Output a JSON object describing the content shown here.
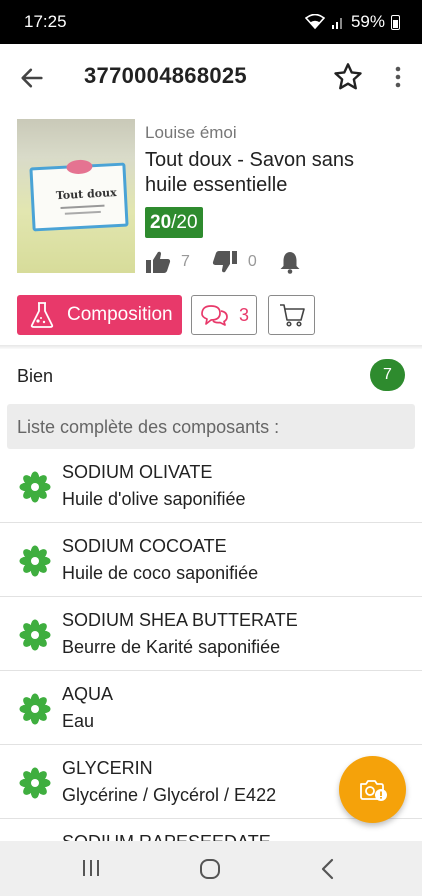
{
  "status_bar": {
    "time": "17:25",
    "battery_text": "59%"
  },
  "app_bar": {
    "title": "3770004868025",
    "back_icon": "arrow-left-icon",
    "favorite_icon": "star-outline-icon",
    "more_icon": "more-vert-icon"
  },
  "product": {
    "brand": "Louise émoi",
    "name": "Tout doux - Savon sans huile essentielle",
    "score_value": "20",
    "score_max": "/20",
    "score_color": "#2e8b2e",
    "likes": "7",
    "dislikes": "0",
    "image_label": "Tout doux"
  },
  "actions": {
    "composition_label": "Composition",
    "comments_count": "3",
    "accent_color": "#e8396a"
  },
  "rating_row": {
    "label": "Bien",
    "count": "7"
  },
  "section": {
    "title": "Liste complète des composants :"
  },
  "ingredients": [
    {
      "name": "SODIUM OLIVATE",
      "description": "Huile d'olive saponifiée",
      "icon": "green-flower-icon"
    },
    {
      "name": "SODIUM COCOATE",
      "description": "Huile de coco saponifiée",
      "icon": "green-flower-icon"
    },
    {
      "name": "SODIUM SHEA BUTTERATE",
      "description": "Beurre de Karité saponifiée",
      "icon": "green-flower-icon"
    },
    {
      "name": "AQUA",
      "description": "Eau",
      "icon": "green-flower-icon"
    },
    {
      "name": "GLYCERIN",
      "description": "Glycérine / Glycérol / E422",
      "icon": "green-flower-icon"
    },
    {
      "name": "SODIUM RAPESEEDATE",
      "description": "",
      "icon": "green-flower-icon"
    }
  ],
  "fab": {
    "icon": "camera-alert-icon",
    "color": "#f5a20a"
  }
}
